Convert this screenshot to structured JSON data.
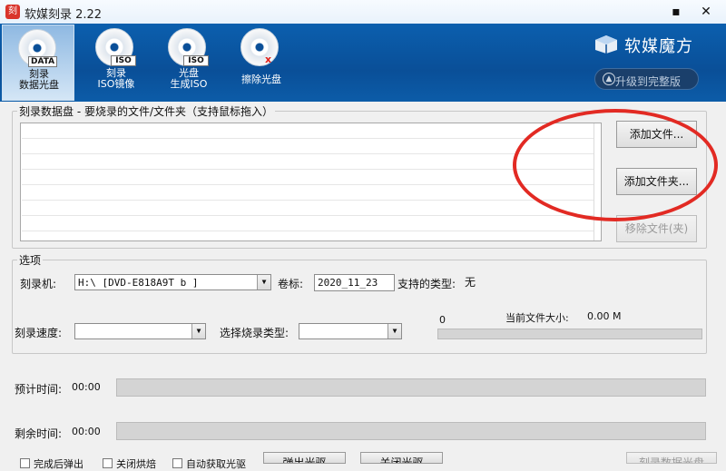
{
  "window": {
    "title": "软媒刻录 2.22",
    "app_icon_label": "刻",
    "minimize_label": "▪",
    "close_label": "✕"
  },
  "toolbar": {
    "tools": [
      {
        "label1": "刻录",
        "label2": "数据光盘",
        "tag": "DATA"
      },
      {
        "label1": "刻录",
        "label2": "ISO镜像",
        "tag": "ISO"
      },
      {
        "label1": "光盘",
        "label2": "生成ISO",
        "tag": "ISO"
      },
      {
        "label1": "擦除光盘",
        "label2": "",
        "tag": "x"
      }
    ],
    "brand": "软媒魔方",
    "upgrade": "升级到完整版"
  },
  "files": {
    "legend": "刻录数据盘 - 要烧录的文件/文件夹（支持鼠标拖入）",
    "add_file": "添加文件...",
    "add_folder": "添加文件夹...",
    "remove": "移除文件(夹)"
  },
  "options": {
    "legend": "选项",
    "burner_label": "刻录机:",
    "burner_value": "H:\\ [DVD-E818A9T   b ]",
    "volume_label": "卷标:",
    "volume_value": "2020_11_23",
    "types_label": "支持的类型:",
    "types_value": "无",
    "speed_label": "刻录速度:",
    "speed_value": "",
    "burn_type_label": "选择烧录类型:",
    "burn_type_value": "",
    "size_zero": "0",
    "size_label": "当前文件大小:",
    "size_value": "0.00 M",
    "size_fraction": 0
  },
  "status": {
    "estimate_label": "预计时间:",
    "estimate_value": "00:00",
    "estimate_fraction": 0,
    "remain_label": "剩余时间:",
    "remain_value": "00:00",
    "remain_fraction": 0
  },
  "bottom": {
    "check1": "完成后弹出",
    "check2": "关闭烘焙",
    "check3": "自动获取光驱",
    "eject": "弹出光驱",
    "close_tray": "关闭光驱",
    "burn": "刻录数据光盘"
  },
  "colors": {
    "toolbar": "#0a4f98",
    "annotation": "#e22a23"
  }
}
